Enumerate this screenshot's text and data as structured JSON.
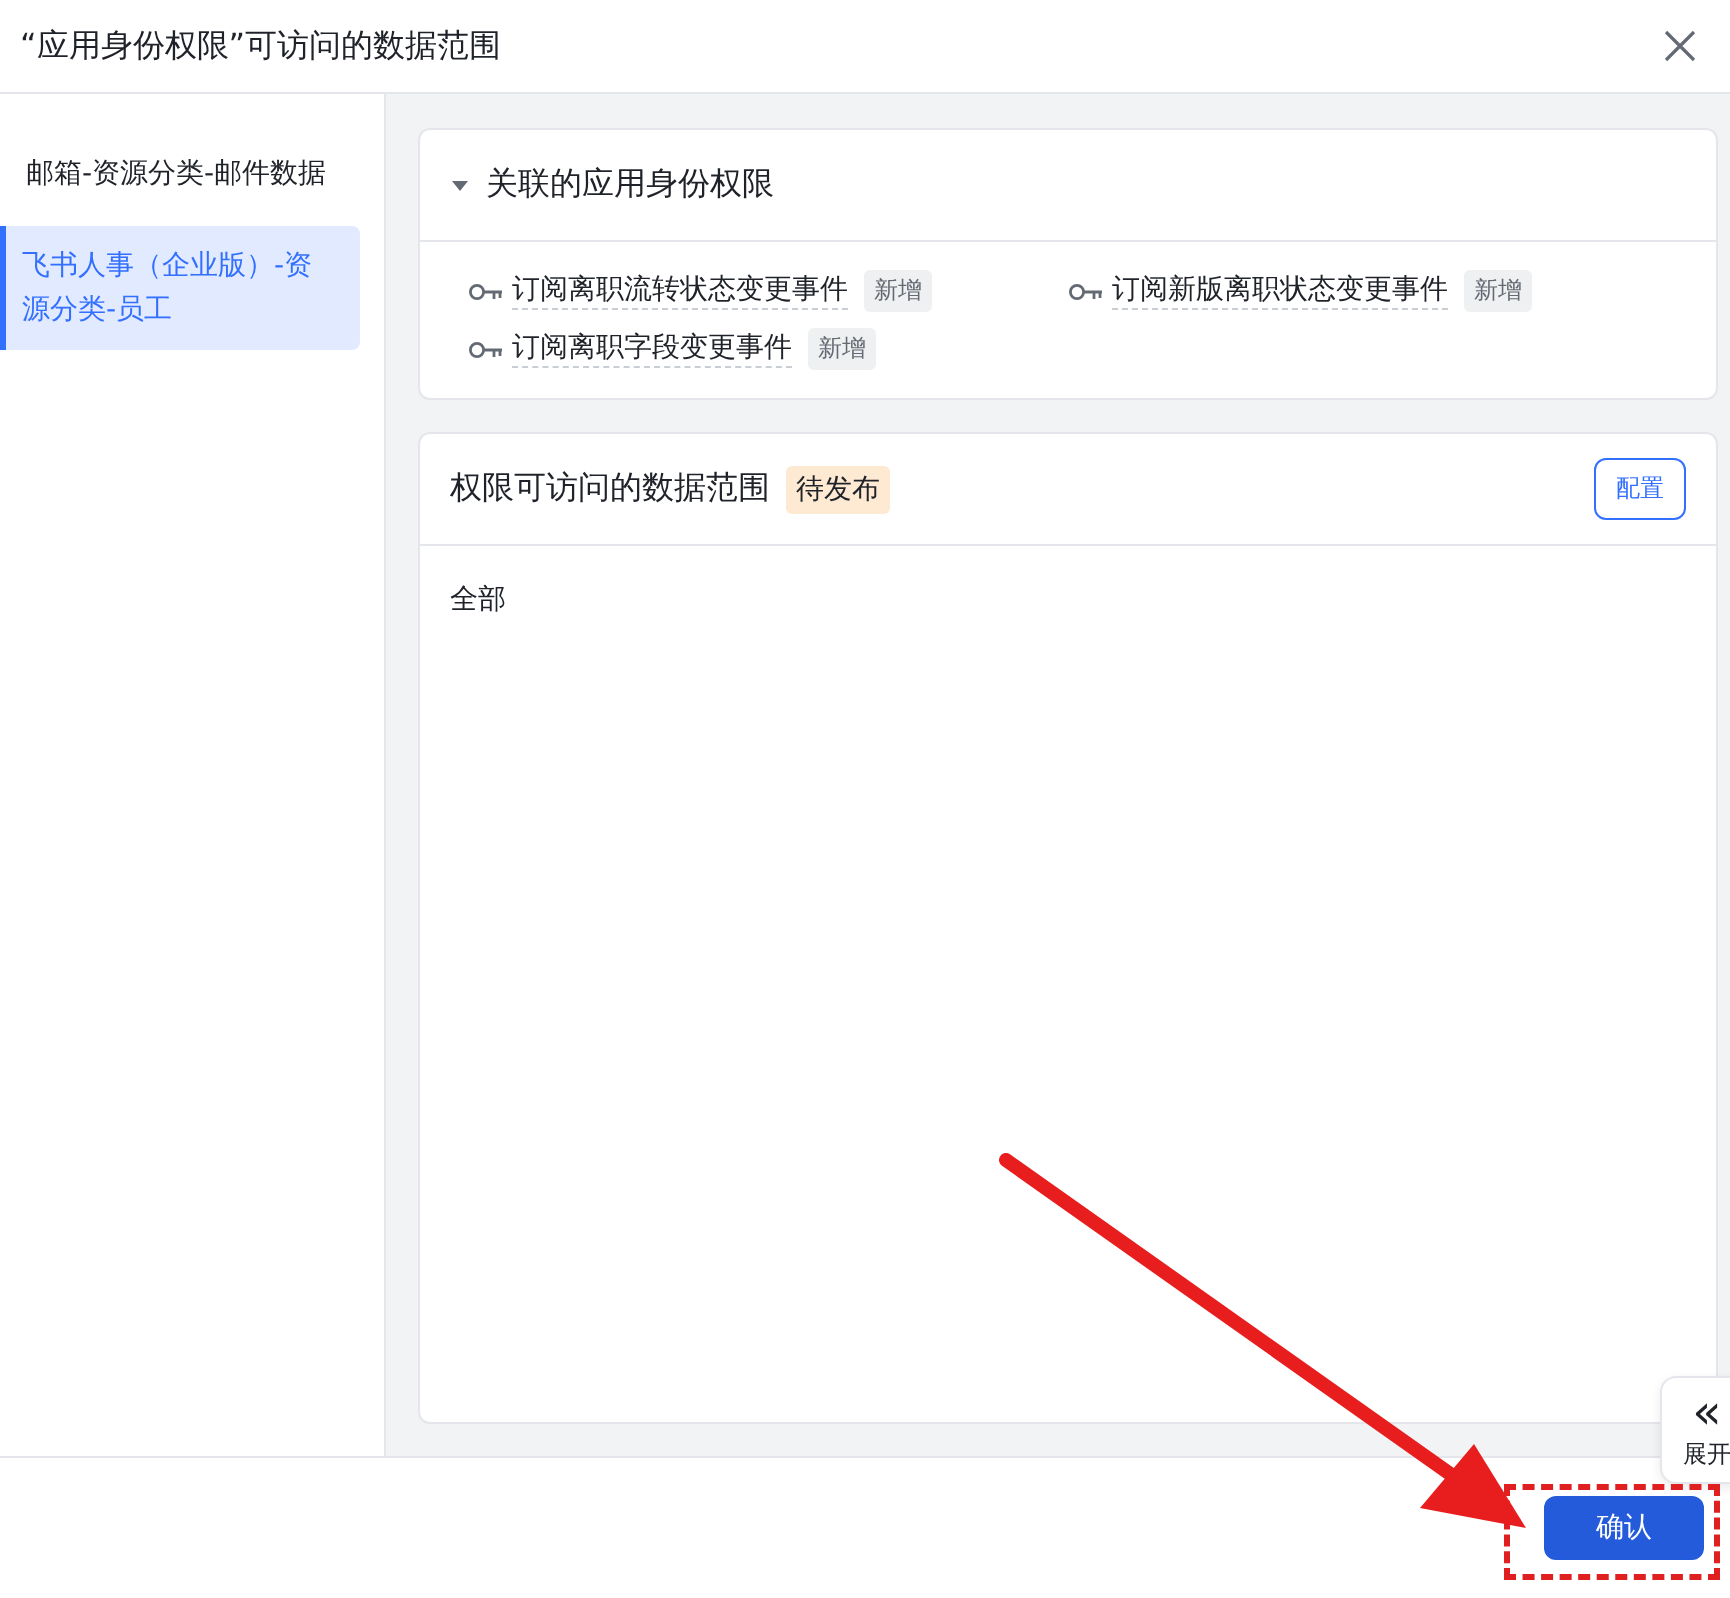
{
  "dialog": {
    "title": "“应用身份权限”可访问的数据范围"
  },
  "sidebar": {
    "items": [
      {
        "label": "邮箱-资源分类-邮件数据",
        "selected": false
      },
      {
        "label": "飞书人事（企业版）-资源分类-员工",
        "selected": true
      }
    ]
  },
  "related_card": {
    "title": "关联的应用身份权限",
    "expanded": true,
    "permissions": [
      {
        "label": "订阅离职流转状态变更事件",
        "tag": "新增"
      },
      {
        "label": "订阅新版离职状态变更事件",
        "tag": "新增"
      },
      {
        "label": "订阅离职字段变更事件",
        "tag": "新增"
      }
    ]
  },
  "scope_card": {
    "title": "权限可访问的数据范围",
    "status": "待发布",
    "config_button": "配置",
    "value": "全部"
  },
  "expand_tab": {
    "icon": "«",
    "label": "展开"
  },
  "footer": {
    "confirm_button": "确认"
  }
}
